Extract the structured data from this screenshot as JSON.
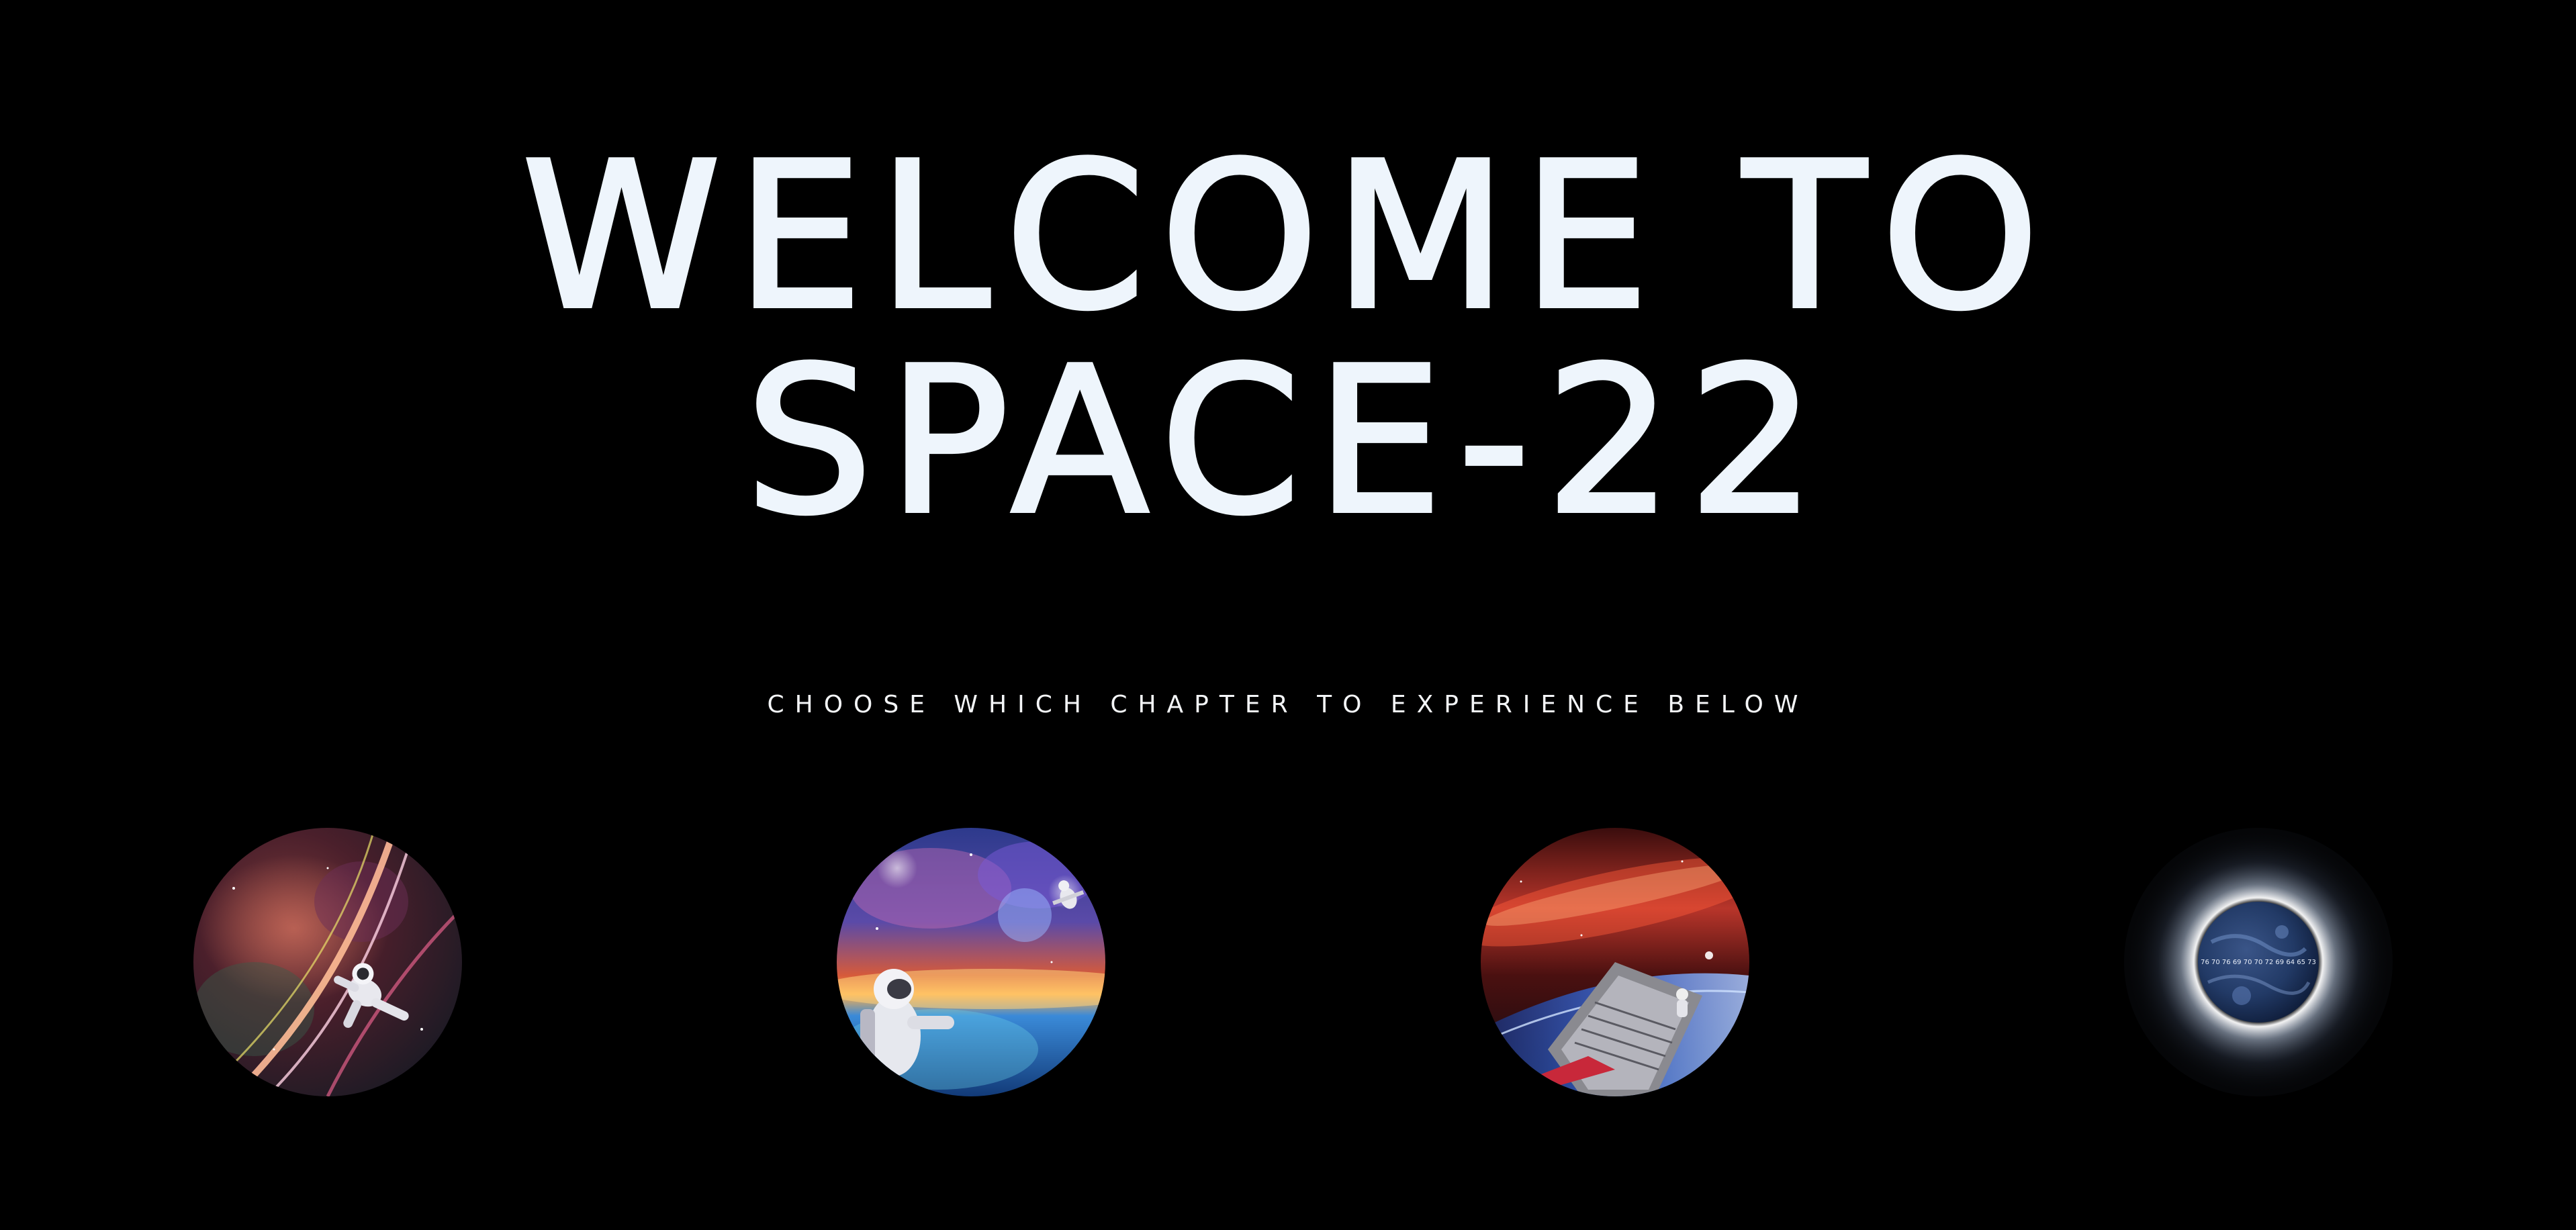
{
  "hero": {
    "title_line1": "WELCOME TO",
    "title_line2": "SPACE-22",
    "subtitle": "CHOOSE WHICH CHAPTER TO EXPERIENCE BELOW"
  },
  "chapters": [
    {
      "image": "astronaut-nebula-warp-thumbnail"
    },
    {
      "image": "astronaut-earth-horizon-thumbnail"
    },
    {
      "image": "spacecraft-milky-way-thumbnail"
    },
    {
      "image": "eclipse-planet-thumbnail",
      "planet_text": "76 70 76 69 70 70 72 69 64 65 73"
    }
  ],
  "colors": {
    "background": "#000000",
    "text": "#eef5fc"
  }
}
